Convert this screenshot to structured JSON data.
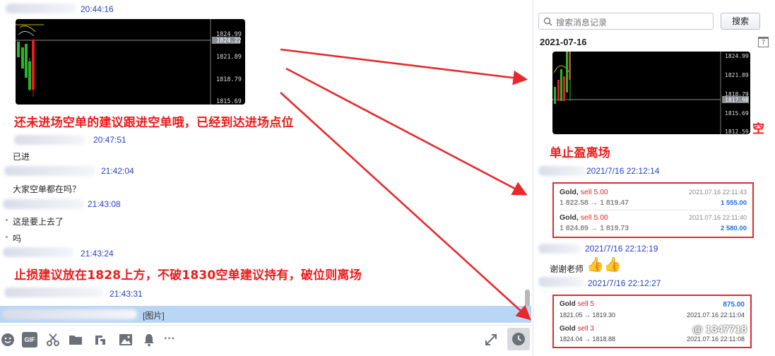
{
  "chat": {
    "messages": [
      {
        "time": "20:44:16"
      },
      {
        "time": "20:47:51",
        "text": "已进"
      },
      {
        "time": "21:42:04",
        "text": "大家空单都在吗？"
      },
      {
        "time": "21:43:08",
        "text": "这是要上去了"
      },
      {
        "text": "吗"
      },
      {
        "time": "21:43:24"
      },
      {
        "time": "21:43:31"
      }
    ],
    "chart_prices": [
      "1824.99",
      "1824.22",
      "1821.89",
      "1818.79",
      "1815.69"
    ],
    "note1": "还未进场空单的建议跟进空单哦，已经到达进场点位",
    "note2": "止损建议放在1828上方，不破1830空单建议持有，破位则离场",
    "input_preview": "[图片]"
  },
  "toolbar": {
    "icons": [
      "emoji-icon",
      "gif-icon",
      "scissors-icon",
      "folder-icon",
      "shake-icon",
      "image-icon",
      "bell-icon",
      "more-icon",
      "expand-icon",
      "history-icon"
    ],
    "gif_label": "GIF",
    "more_label": "···"
  },
  "history": {
    "search_placeholder": "搜索消息记录",
    "search_button": "搜索",
    "date": "2021-07-16",
    "calendar_label": "7",
    "chart_prices": [
      "1824.99",
      "1821.89",
      "1818.79",
      "1817.98",
      "1815.69",
      "1812.59"
    ],
    "note_tail": "空",
    "note_line2": "单止盈离场",
    "entries": [
      {
        "time": "2021/7/16 22:12:14"
      },
      {
        "time": "2021/7/16 22:12:19",
        "text": "谢谢老师",
        "emoji": "👍👍"
      },
      {
        "time": "2021/7/16 22:12:27"
      }
    ],
    "trades_a": [
      {
        "symbol": "Gold,",
        "side": "sell 5.00",
        "datetime": "2021.07.16 22:11:43",
        "prices": "1 822.58 → 1 819.47",
        "profit": "1 555.00"
      },
      {
        "symbol": "Gold,",
        "side": "sell 5.00",
        "datetime": "2021.07.16 22:11:40",
        "prices": "1 824.89 → 1 819.73",
        "profit": "2 580.00"
      }
    ],
    "trades_b": [
      {
        "symbol": "Gold",
        "side": "sell 5",
        "profit": "875.00",
        "prices": "1821.05 → 1819.30",
        "datetime": "2021.07.16 22:11:04"
      },
      {
        "symbol": "Gold",
        "side": "sell 3",
        "profit": "",
        "prices": "1824.04 → 1818.88",
        "datetime": "2021.07.16 22:11:08"
      }
    ],
    "watermark": "@ 1347718"
  },
  "colors": {
    "timestamp": "#2a3fc6",
    "annotation": "#ee1a1a",
    "trade_border": "#e32a2a",
    "profit": "#1e6fd9",
    "input_strip": "#b9d7f5"
  }
}
